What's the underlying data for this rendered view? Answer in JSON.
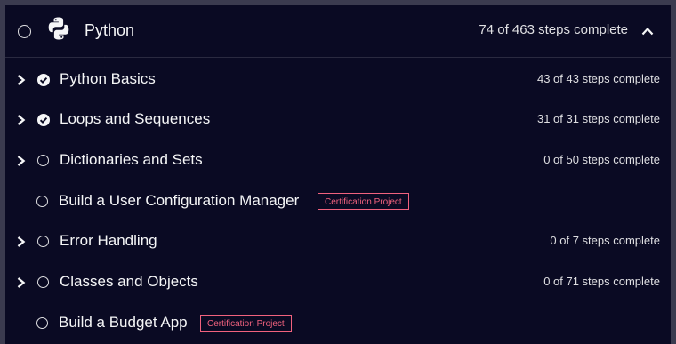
{
  "colors": {
    "background": "#0a0a23",
    "text": "#f5f6f7",
    "badge": "#f1627e"
  },
  "header": {
    "title": "Python",
    "progress": "74 of 463 steps complete",
    "icon": "python-logo-icon",
    "expanded": true
  },
  "blocks": [
    {
      "title": "Python Basics",
      "progress": "43 of 43 steps complete",
      "complete": true
    },
    {
      "title": "Loops and Sequences",
      "progress": "31 of 31 steps complete",
      "complete": true
    },
    {
      "title": "Dictionaries and Sets",
      "progress": "0 of 50 steps complete",
      "complete": false
    },
    {
      "title": "Build a User Configuration Manager",
      "badge": "Certification Project",
      "complete": false
    },
    {
      "title": "Error Handling",
      "progress": "0 of 7 steps complete",
      "complete": false
    },
    {
      "title": "Classes and Objects",
      "progress": "0 of 71 steps complete",
      "complete": false
    },
    {
      "title": "Build a Budget App",
      "badge": "Certification Project",
      "complete": false
    }
  ]
}
